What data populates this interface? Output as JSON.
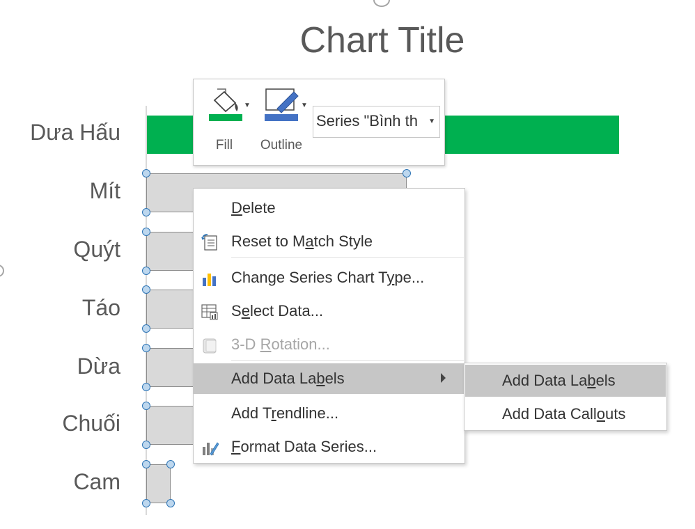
{
  "chart": {
    "title": "Chart Title",
    "categories": [
      "Dưa Hấu",
      "Mít",
      "Quýt",
      "Táo",
      "Dừa",
      "Chuối",
      "Cam"
    ]
  },
  "mini_toolbar": {
    "fill_label": "Fill",
    "outline_label": "Outline",
    "series_value": "Series \"Bình th",
    "fill_color": "#00b050",
    "outline_color": "#4472c4"
  },
  "context_menu": {
    "delete": [
      "",
      "D",
      "elete"
    ],
    "reset": [
      "Reset to M",
      "a",
      "tch Style"
    ],
    "change_type": [
      "Change Series Chart T",
      "y",
      "pe..."
    ],
    "select_data": [
      "S",
      "e",
      "lect Data..."
    ],
    "rotation": [
      "3-D ",
      "R",
      "otation..."
    ],
    "add_labels": [
      "Add Data La",
      "b",
      "els"
    ],
    "trendline": [
      "Add T",
      "r",
      "endline..."
    ],
    "format_series": [
      "",
      "F",
      "ormat Data Series..."
    ]
  },
  "submenu": {
    "add_labels": [
      "Add Data La",
      "b",
      "els"
    ],
    "add_callouts": [
      "Add Data Call",
      "o",
      "uts"
    ]
  },
  "colors": {
    "series_green": "#00b050",
    "selected_bar": "#d9d9d9",
    "highlight": "#c6c6c6"
  }
}
